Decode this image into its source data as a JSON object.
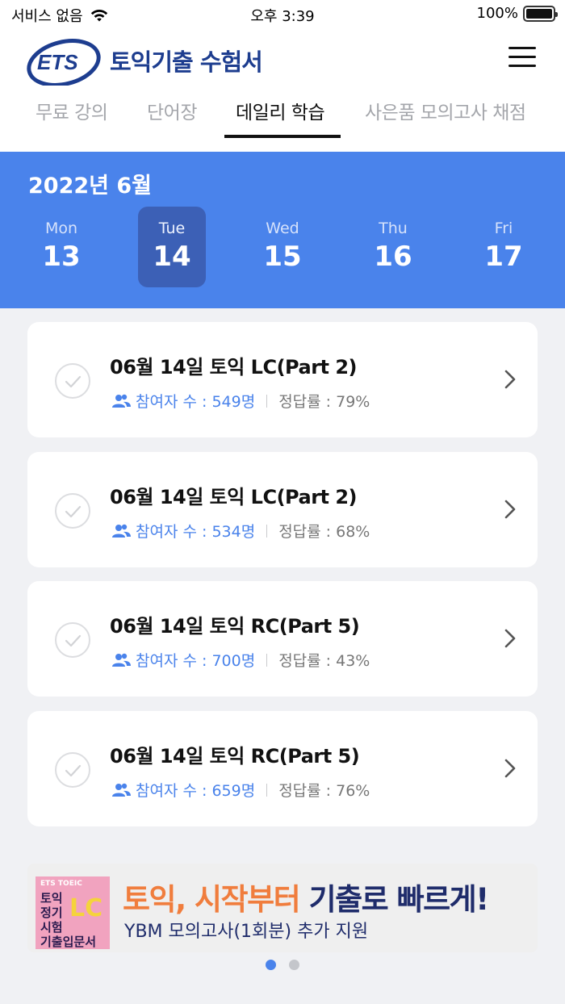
{
  "status_bar": {
    "carrier": "서비스 없음",
    "time": "오후 3:39",
    "battery": "100%"
  },
  "header": {
    "logo_text": "ETS",
    "app_title": "토익기출 수험서",
    "menu_icon": "hamburger-menu-icon"
  },
  "tabs": [
    {
      "label": "무료 강의",
      "active": false
    },
    {
      "label": "단어장",
      "active": false
    },
    {
      "label": "데일리 학습",
      "active": true
    },
    {
      "label": "사은품 모의고사 채점",
      "active": false
    }
  ],
  "calendar": {
    "month": "2022년 6월",
    "days": [
      {
        "dow": "Mon",
        "num": "13",
        "active": false
      },
      {
        "dow": "Tue",
        "num": "14",
        "active": true
      },
      {
        "dow": "Wed",
        "num": "15",
        "active": false
      },
      {
        "dow": "Thu",
        "num": "16",
        "active": false
      },
      {
        "dow": "Fri",
        "num": "17",
        "active": false
      }
    ]
  },
  "quizzes": [
    {
      "title": "06월 14일 토익 LC(Part 2)",
      "participants": "참여자 수 : 549명",
      "accuracy": "정답률 : 79%"
    },
    {
      "title": "06월 14일 토익 LC(Part 2)",
      "participants": "참여자 수 : 534명",
      "accuracy": "정답률 : 68%"
    },
    {
      "title": "06월 14일 토익 RC(Part 5)",
      "participants": "참여자 수 : 700명",
      "accuracy": "정답률 : 43%"
    },
    {
      "title": "06월 14일 토익 RC(Part 5)",
      "participants": "참여자 수 : 659명",
      "accuracy": "정답률 : 76%"
    }
  ],
  "banner": {
    "book_tag": "ETS TOEIC",
    "book_big": "LC",
    "book_text": "토익\n정기\n시험\n기출입문서",
    "headline_orange": "토익, 시작부터",
    "headline_navy": "기출로 빠르게!",
    "subtitle": "YBM 모의고사(1회분) 추가 지원"
  },
  "pagination": {
    "count": 2,
    "active_index": 0
  },
  "colors": {
    "accent": "#4a83eb",
    "selected_day": "#3c60b6",
    "brand_navy": "#1d3d8f",
    "banner_orange": "#f07d3d"
  }
}
